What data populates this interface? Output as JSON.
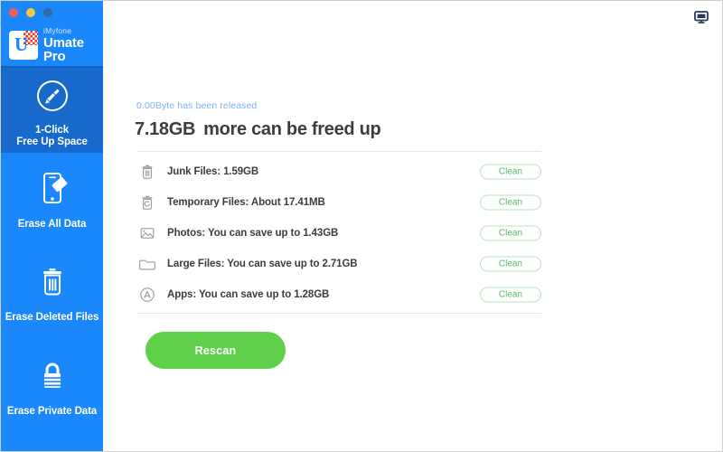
{
  "window": {
    "controls": [
      {
        "name": "close",
        "color": "#f9595a"
      },
      {
        "name": "minimize",
        "color": "#fbc73b"
      },
      {
        "name": "zoom",
        "color": "#2f6ca5"
      }
    ]
  },
  "brand": {
    "top_label": "iMyfone",
    "bottom_label": "Umate Pro",
    "logo_icon": "umate-logo-icon"
  },
  "sidebar": {
    "accent_color": "#1a87fb",
    "selected_color": "#1869cc",
    "items": [
      {
        "label": "1-Click\nFree Up Space",
        "icon": "broom-circle-icon",
        "selected": true
      },
      {
        "label": "Erase All Data",
        "icon": "phone-erase-icon",
        "selected": false
      },
      {
        "label": "Erase Deleted Files",
        "icon": "trash-icon",
        "selected": false
      },
      {
        "label": "Erase Private Data",
        "icon": "padlock-icon",
        "selected": false
      }
    ]
  },
  "main": {
    "feedback_icon": "feedback-bubble-icon",
    "status_released": "0.00Byte  has been released",
    "headline_amount": "7.18GB",
    "headline_text": "more can be freed up",
    "clean_button_label": "Clean",
    "rescan_button_label": "Rescan",
    "rows": [
      {
        "label": "Junk Files: 1.59GB",
        "icon": "trash-icon",
        "action": "Clean"
      },
      {
        "label": "Temporary Files: About 17.41MB",
        "icon": "temporary-files-icon",
        "action": "Clean"
      },
      {
        "label": "Photos: You can save up to 1.43GB",
        "icon": "photo-icon",
        "action": "Clean"
      },
      {
        "label": "Large Files: You can save up to 2.71GB",
        "icon": "folder-icon",
        "action": "Clean"
      },
      {
        "label": "Apps: You can save up to 1.28GB",
        "icon": "apps-icon",
        "action": "Clean"
      }
    ]
  },
  "colors": {
    "sidebar_blue": "#1a87fb",
    "selected_blue": "#1869cc",
    "status_blue": "#7db2ef",
    "green_primary": "#5ed04a",
    "green_outline_text": "#56b965",
    "green_outline_border": "#b9e4bd",
    "text_dark": "#3d3d3d"
  }
}
